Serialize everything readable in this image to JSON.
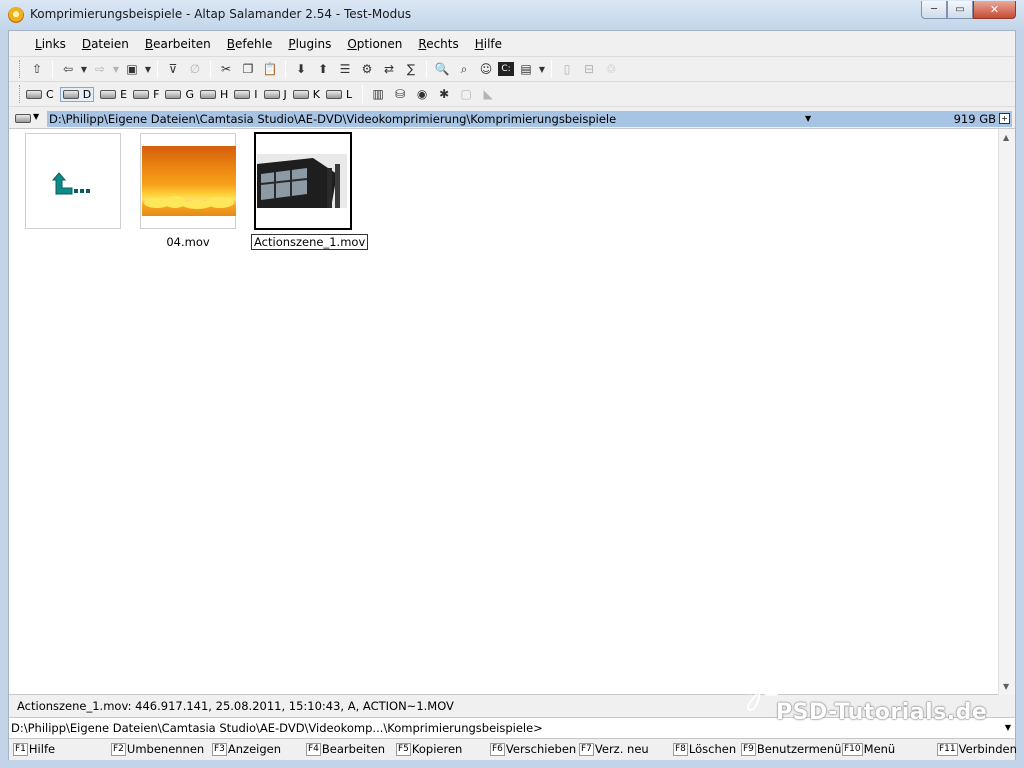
{
  "window": {
    "title": "Komprimierungsbeispiele - Altap Salamander 2.54 - Test-Modus",
    "caption_minimize": "─",
    "caption_maximize": "▭",
    "caption_close": "✕"
  },
  "menu": [
    {
      "u": "L",
      "rest": "inks"
    },
    {
      "u": "D",
      "rest": "ateien"
    },
    {
      "u": "B",
      "rest": "earbeiten"
    },
    {
      "u": "B",
      "rest": "efehle"
    },
    {
      "u": "P",
      "rest": "lugins"
    },
    {
      "u": "O",
      "rest": "ptionen"
    },
    {
      "u": "R",
      "rest": "echts"
    },
    {
      "u": "H",
      "rest": "ilfe"
    }
  ],
  "drives": [
    "C",
    "D",
    "E",
    "F",
    "G",
    "H",
    "I",
    "J",
    "K",
    "L"
  ],
  "path": {
    "current": "D:\\Philipp\\Eigene Dateien\\Camtasia Studio\\AE-DVD\\Videokomprimierung\\Komprimierungsbeispiele",
    "free_space": "919 GB"
  },
  "files": [
    {
      "name": "",
      "type": "up-dir"
    },
    {
      "name": "04.mov",
      "type": "video"
    },
    {
      "name": "Actionszene_1.mov",
      "type": "video"
    }
  ],
  "status": {
    "info": "Actionszene_1.mov: 446.917.141, 25.08.2011, 15:10:43, A, ACTION~1.MOV",
    "command_line": "D:\\Philipp\\Eigene Dateien\\Camtasia Studio\\AE-DVD\\Videokomp...\\Komprimierungsbeispiele>"
  },
  "fkeys": [
    {
      "key": "F1",
      "label": "Hilfe"
    },
    {
      "key": "F2",
      "label": "Umbenennen"
    },
    {
      "key": "F3",
      "label": "Anzeigen"
    },
    {
      "key": "F4",
      "label": "Bearbeiten"
    },
    {
      "key": "F5",
      "label": "Kopieren"
    },
    {
      "key": "F6",
      "label": "Verschieben"
    },
    {
      "key": "F7",
      "label": "Verz. neu"
    },
    {
      "key": "F8",
      "label": "Löschen"
    },
    {
      "key": "F9",
      "label": "Benutzermenü"
    },
    {
      "key": "F10",
      "label": "Menü"
    },
    {
      "key": "F11",
      "label": "Verbinden"
    }
  ],
  "watermark": "PSD-Tutorials.de"
}
